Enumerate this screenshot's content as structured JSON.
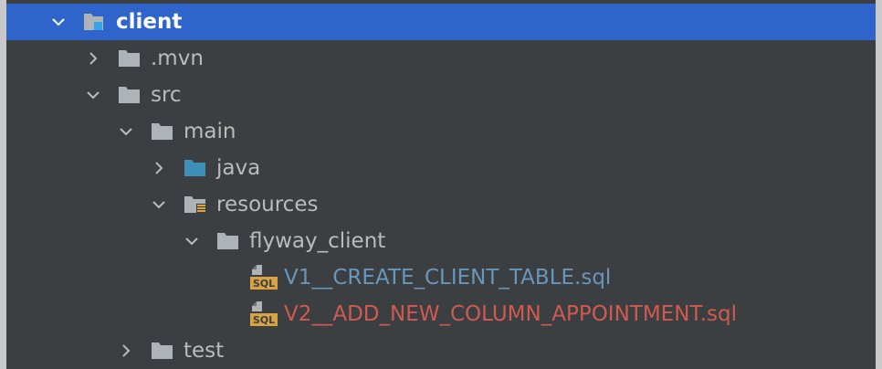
{
  "tree": {
    "items": [
      {
        "label": "client",
        "expanded": true,
        "icon": "module-folder-icon",
        "selected": true
      },
      {
        "label": ".mvn",
        "expanded": false,
        "icon": "folder-icon"
      },
      {
        "label": "src",
        "expanded": true,
        "icon": "folder-icon"
      },
      {
        "label": "main",
        "expanded": true,
        "icon": "folder-icon"
      },
      {
        "label": "java",
        "expanded": false,
        "icon": "source-folder-icon"
      },
      {
        "label": "resources",
        "expanded": true,
        "icon": "resources-folder-icon"
      },
      {
        "label": "flyway_client",
        "expanded": true,
        "icon": "folder-icon"
      },
      {
        "label": "V1__CREATE_CLIENT_TABLE.sql",
        "icon": "sql-file-icon",
        "status_color": "#6897bb"
      },
      {
        "label": "V2__ADD_NEW_COLUMN_APPOINTMENT.sql",
        "icon": "sql-file-icon",
        "status_color": "#d05a4f"
      },
      {
        "label": "test",
        "expanded": false,
        "icon": "folder-icon"
      }
    ]
  },
  "colors": {
    "background": "#3c3f41",
    "selection": "#2f65ca",
    "folder": "#aeb3b8",
    "source_folder": "#3d8fb8",
    "sql_badge": "#d9a343"
  }
}
